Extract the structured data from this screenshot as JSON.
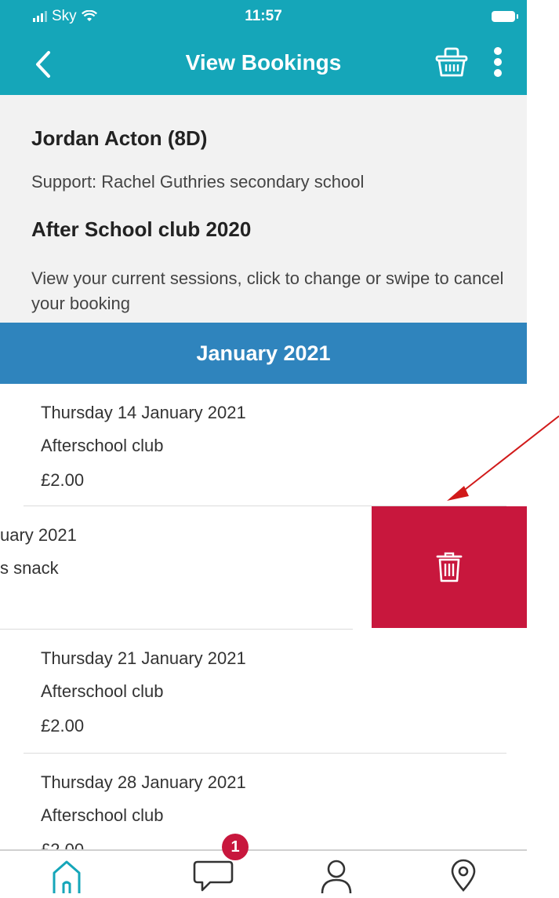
{
  "status_bar": {
    "carrier": "Sky",
    "time": "11:57"
  },
  "header": {
    "title": "View Bookings"
  },
  "info": {
    "name": "Jordan Acton (8D)",
    "support": "Support: Rachel Guthries secondary school",
    "club": "After School club 2020",
    "description": "View your current sessions, click to change or swipe to cancel your booking"
  },
  "month": "January 2021",
  "bookings": [
    {
      "date": "Thursday 14 January 2021",
      "activity": "Afterschool club",
      "price": "£2.00"
    },
    {
      "date": "uary 2021",
      "activity": "s snack",
      "price": ""
    },
    {
      "date": "Thursday 21 January 2021",
      "activity": "Afterschool club",
      "price": "£2.00"
    },
    {
      "date": "Thursday 28 January 2021",
      "activity": "Afterschool club",
      "price": "£2.00"
    }
  ],
  "tabbar": {
    "messages_badge": "1"
  },
  "colors": {
    "header": "#15a6b9",
    "month_bar": "#2f84bd",
    "delete": "#c8173d",
    "arrow": "#d11a1a"
  },
  "icons": [
    "back-chevron-icon",
    "basket-icon",
    "more-vertical-icon",
    "trash-icon",
    "home-icon",
    "chat-icon",
    "profile-icon",
    "location-icon"
  ]
}
